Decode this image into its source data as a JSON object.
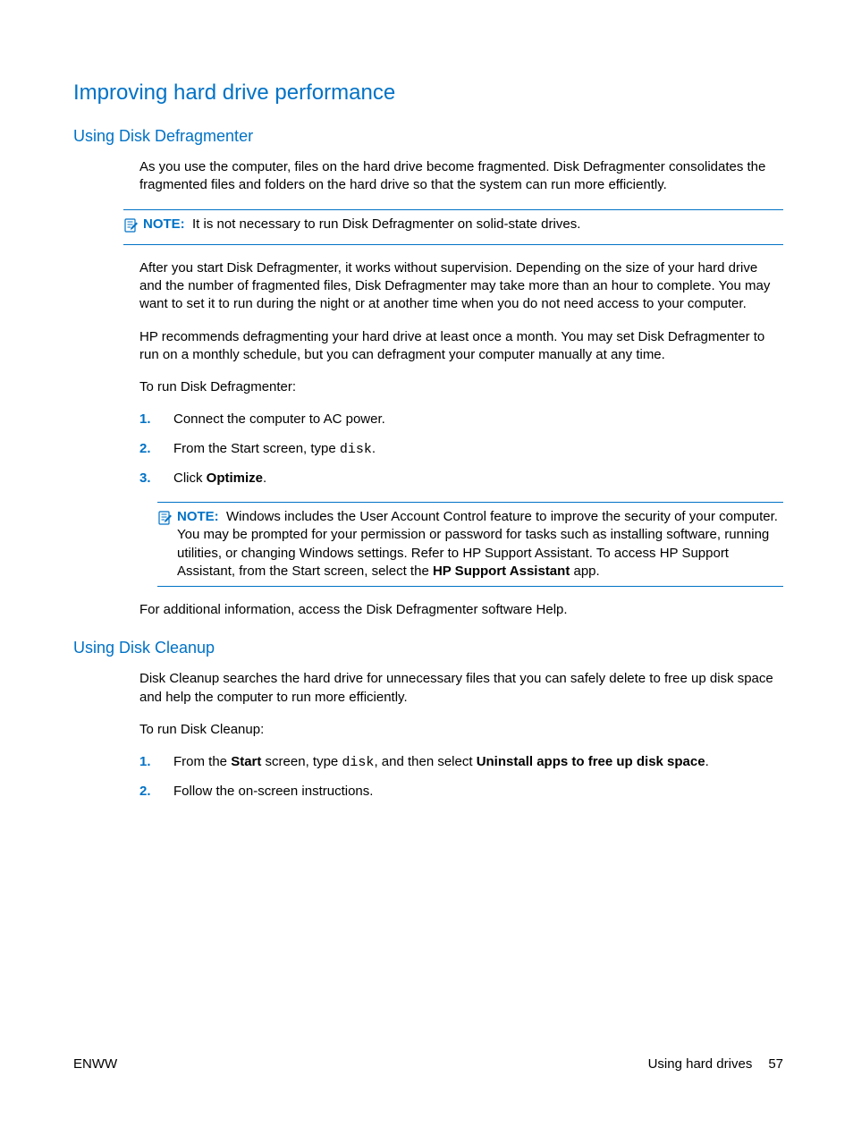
{
  "heading1": "Improving hard drive performance",
  "section1": {
    "heading": "Using Disk Defragmenter",
    "p1": "As you use the computer, files on the hard drive become fragmented. Disk Defragmenter consolidates the fragmented files and folders on the hard drive so that the system can run more efficiently.",
    "note1": {
      "label": "NOTE:",
      "text": "It is not necessary to run Disk Defragmenter on solid-state drives."
    },
    "p2": "After you start Disk Defragmenter, it works without supervision. Depending on the size of your hard drive and the number of fragmented files, Disk Defragmenter may take more than an hour to complete. You may want to set it to run during the night or at another time when you do not need access to your computer.",
    "p3": "HP recommends defragmenting your hard drive at least once a month. You may set Disk Defragmenter to run on a monthly schedule, but you can defragment your computer manually at any time.",
    "p4": "To run Disk Defragmenter:",
    "steps": {
      "s1": "Connect the computer to AC power.",
      "s2a": "From the Start screen, type ",
      "s2code": "disk",
      "s2b": ".",
      "s3a": "Click ",
      "s3bold": "Optimize",
      "s3b": "."
    },
    "note2": {
      "label": "NOTE:",
      "text_a": "Windows includes the User Account Control feature to improve the security of your computer. You may be prompted for your permission or password for tasks such as installing software, running utilities, or changing Windows settings. Refer to HP Support Assistant. To access HP Support Assistant, from the Start screen, select the ",
      "text_bold": "HP Support Assistant",
      "text_b": " app."
    },
    "p5": "For additional information, access the Disk Defragmenter software Help."
  },
  "section2": {
    "heading": "Using Disk Cleanup",
    "p1": "Disk Cleanup searches the hard drive for unnecessary files that you can safely delete to free up disk space and help the computer to run more efficiently.",
    "p2": "To run Disk Cleanup:",
    "steps": {
      "s1a": "From the ",
      "s1b1": "Start",
      "s1c": " screen, type ",
      "s1code": "disk",
      "s1d": ", and then select ",
      "s1b2": "Uninstall apps to free up disk space",
      "s1e": ".",
      "s2": "Follow the on-screen instructions."
    }
  },
  "footer": {
    "left": "ENWW",
    "right_label": "Using hard drives",
    "page": "57"
  }
}
